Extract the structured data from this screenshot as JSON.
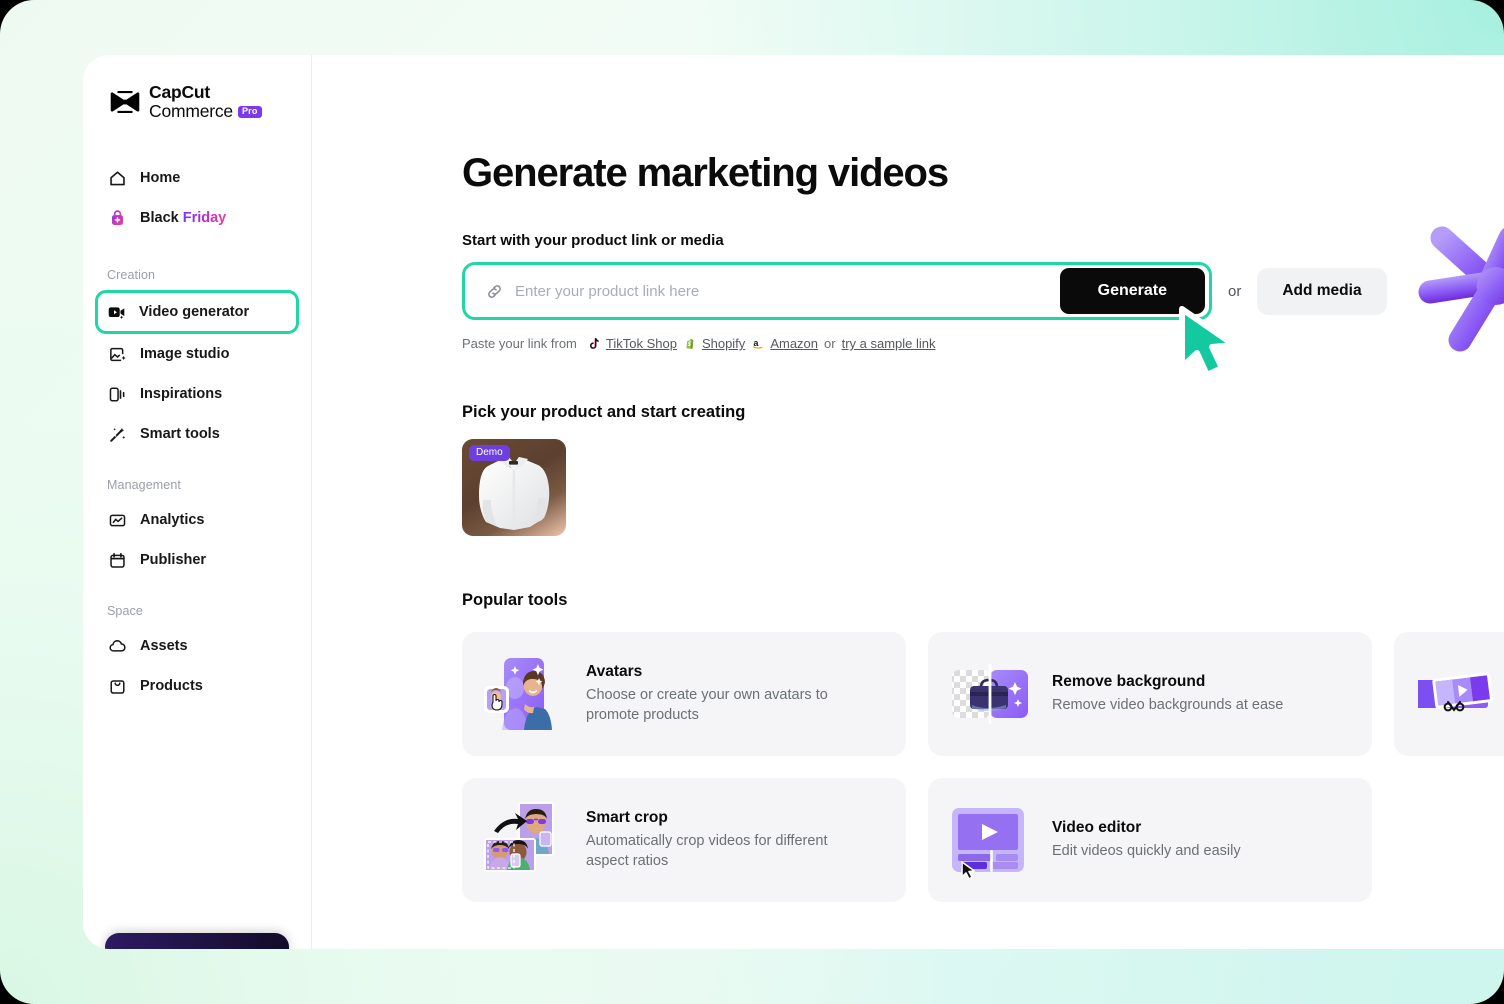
{
  "brand": {
    "logo_line1": "CapCut",
    "logo_line2": "Commerce",
    "pro_badge": "Pro",
    "logo_icon": "capcut-logo-icon",
    "accent_teal": "#1ed6a6",
    "accent_purple": "#7c3aed",
    "accent_black": "#0a0a0b"
  },
  "sidebar": {
    "top_items": [
      {
        "label": "Home",
        "icon": "home-icon",
        "name": "home"
      },
      {
        "label": "Black Friday",
        "label_a": "Black ",
        "label_b": "Friday",
        "icon": "gift-bag-icon",
        "name": "black-friday"
      }
    ],
    "sections": [
      {
        "title": "Creation",
        "items": [
          {
            "label": "Video generator",
            "icon": "video-generator-icon",
            "name": "video-generator",
            "selected": true
          },
          {
            "label": "Image studio",
            "icon": "image-studio-icon",
            "name": "image-studio",
            "selected": false
          },
          {
            "label": "Inspirations",
            "icon": "inspirations-icon",
            "name": "inspirations",
            "selected": false
          },
          {
            "label": "Smart tools",
            "icon": "magic-wand-icon",
            "name": "smart-tools",
            "selected": false
          }
        ]
      },
      {
        "title": "Management",
        "items": [
          {
            "label": "Analytics",
            "icon": "analytics-icon",
            "name": "analytics",
            "selected": false
          },
          {
            "label": "Publisher",
            "icon": "calendar-icon",
            "name": "publisher",
            "selected": false
          }
        ]
      },
      {
        "title": "Space",
        "items": [
          {
            "label": "Assets",
            "icon": "cloud-icon",
            "name": "assets",
            "selected": false
          },
          {
            "label": "Products",
            "icon": "products-bag-icon",
            "name": "products",
            "selected": false
          }
        ]
      }
    ]
  },
  "main": {
    "title": "Generate marketing videos",
    "start_label": "Start with your product link or media",
    "link_input": {
      "value": "",
      "placeholder": "Enter your product link here",
      "icon": "link-chain-icon"
    },
    "generate_button": "Generate",
    "or": "or",
    "add_media_button": "Add media",
    "paste_row": {
      "prefix": "Paste your link from",
      "sources": [
        {
          "label": "TikTok Shop",
          "icon": "tiktok-icon"
        },
        {
          "label": "Shopify",
          "icon": "shopify-icon"
        },
        {
          "label": "Amazon",
          "icon": "amazon-icon"
        }
      ],
      "or": "or",
      "sample_link": "try a sample link"
    },
    "pick_product": {
      "title": "Pick your product and start creating",
      "items": [
        {
          "badge": "Demo",
          "name": "white-dress-shirt",
          "alt": "white dress shirt product thumbnail"
        }
      ]
    },
    "popular_tools": {
      "title": "Popular tools",
      "items": [
        {
          "title": "Avatars",
          "desc": "Choose or create your own avatars to promote products",
          "thumb": "avatars-thumb"
        },
        {
          "title": "Remove background",
          "desc": "Remove video backgrounds at ease",
          "thumb": "remove-background-thumb"
        },
        {
          "title": "Smart crop",
          "desc": "Automatically crop videos for different aspect ratios",
          "thumb": "smart-crop-thumb"
        },
        {
          "title": "Video editor",
          "desc": "Edit videos quickly and easily",
          "thumb": "video-editor-thumb"
        },
        {
          "title": "",
          "desc": "",
          "thumb": "video-trim-thumb"
        }
      ]
    }
  },
  "decor": {
    "star": "purple-3d-star",
    "cursor": "teal-arrow-cursor"
  }
}
